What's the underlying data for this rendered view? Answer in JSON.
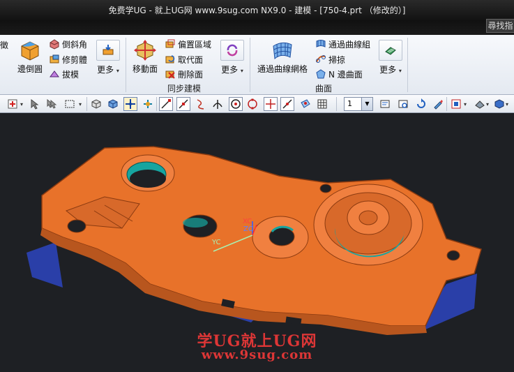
{
  "window": {
    "title": "免费学UG - 就上UG网 www.9sug.com NX9.0 - 建模 - [750-4.prt （修改的）]",
    "search_tab": "尋找指"
  },
  "ribbon": {
    "clipped_left_label": "徵",
    "edge_blend": "邊倒圓",
    "chamfer": "倒斜角",
    "trim_body": "修剪體",
    "draft": "拔模",
    "more1": "更多",
    "move_face": "移動面",
    "offset_region": "偏置區域",
    "replace_face": "取代面",
    "delete_face": "刪除面",
    "more2": "更多",
    "group_sync": "同步建模",
    "through_curve_mesh": "通過曲線網格",
    "through_curves": "通過曲線組",
    "swept": "掃掠",
    "n_sided_surface": "N 邊曲面",
    "more3": "更多",
    "group_surface": "曲面"
  },
  "toolbar": {
    "layer_value": "1"
  },
  "viewport": {
    "axis_xc": "XC",
    "axis_zc": "ZC",
    "axis_yc": "YC",
    "watermark_line1": "学UG就上UG网",
    "watermark_line2": "www.9sug.com",
    "part_color": "#e8722a",
    "inner_color": "#16a5a0",
    "underside_color": "#2a3fa8",
    "background": "#1e2024"
  }
}
